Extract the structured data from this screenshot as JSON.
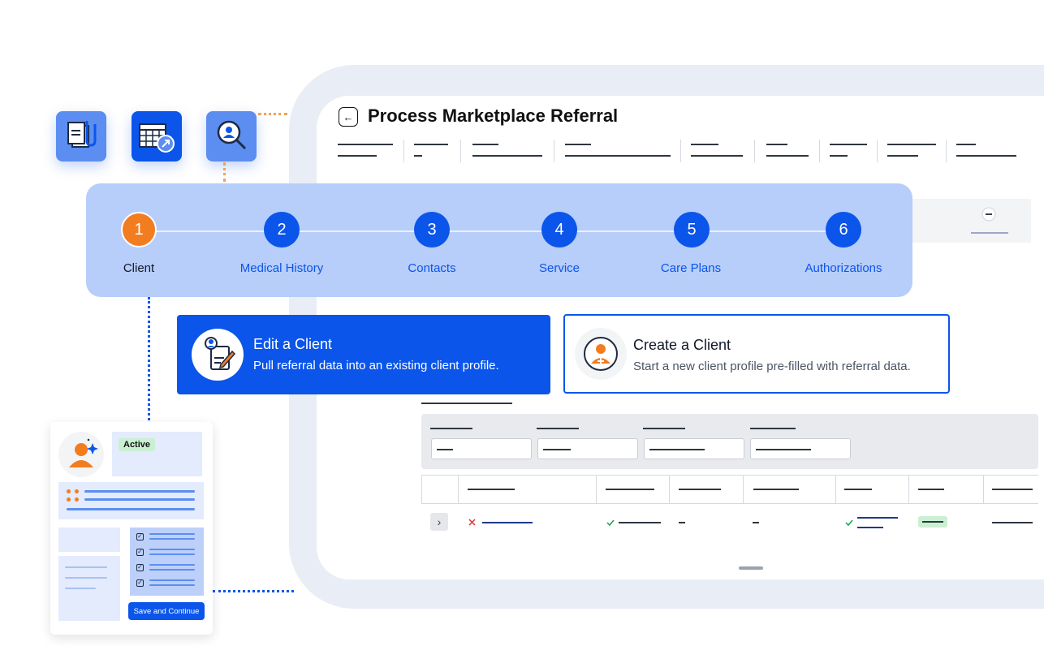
{
  "header": {
    "back_icon": "arrow-left-icon",
    "title": "Process Marketplace Referral"
  },
  "stepper": {
    "steps": [
      {
        "number": "1",
        "label": "Client",
        "active": true
      },
      {
        "number": "2",
        "label": "Medical History",
        "active": false
      },
      {
        "number": "3",
        "label": "Contacts",
        "active": false
      },
      {
        "number": "4",
        "label": "Service",
        "active": false
      },
      {
        "number": "5",
        "label": "Care Plans",
        "active": false
      },
      {
        "number": "6",
        "label": "Authorizations",
        "active": false
      }
    ]
  },
  "options": {
    "edit": {
      "title": "Edit a Client",
      "subtitle": "Pull referral data into an existing client profile."
    },
    "create": {
      "title": "Create a Client",
      "subtitle": "Start a new client profile pre-filled with referral data."
    }
  },
  "mini_form": {
    "status": "Active",
    "save_label": "Save and Continue"
  },
  "colors": {
    "primary": "#0b55ea",
    "accent": "#f27d21",
    "stepper_bg": "#b7cdfa",
    "success_bg": "#c9f0d2"
  }
}
